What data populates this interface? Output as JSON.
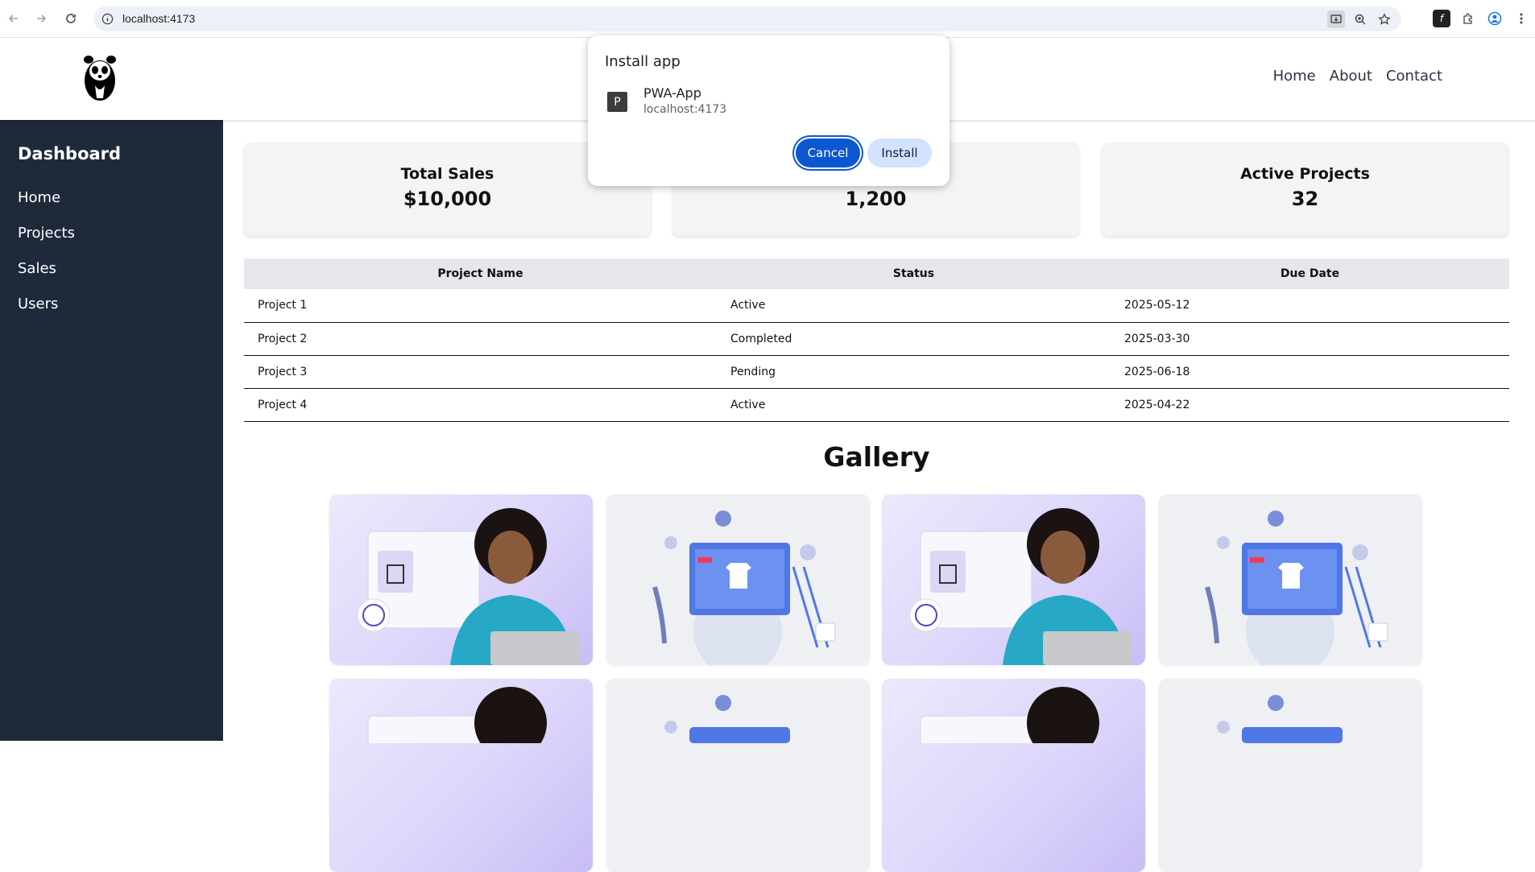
{
  "browser": {
    "url": "localhost:4173"
  },
  "header": {
    "nav": [
      "Home",
      "About",
      "Contact"
    ]
  },
  "sidebar": {
    "title": "Dashboard",
    "items": [
      "Home",
      "Projects",
      "Sales",
      "Users"
    ]
  },
  "cards": [
    {
      "label": "Total Sales",
      "value": "$10,000"
    },
    {
      "label": "",
      "value": "1,200"
    },
    {
      "label": "Active Projects",
      "value": "32"
    }
  ],
  "table": {
    "headers": [
      "Project Name",
      "Status",
      "Due Date"
    ],
    "rows": [
      [
        "Project 1",
        "Active",
        "2025-05-12"
      ],
      [
        "Project 2",
        "Completed",
        "2025-03-30"
      ],
      [
        "Project 3",
        "Pending",
        "2025-06-18"
      ],
      [
        "Project 4",
        "Active",
        "2025-04-22"
      ]
    ]
  },
  "gallery": {
    "title": "Gallery"
  },
  "install_popup": {
    "title": "Install app",
    "app_initial": "P",
    "app_name": "PWA-App",
    "app_url": "localhost:4173",
    "cancel_label": "Cancel",
    "install_label": "Install"
  },
  "colors": {
    "sidebar_bg": "#1e2939",
    "card_bg": "#f3f4f6",
    "table_header_bg": "#e5e7eb",
    "primary_button": "#0b57d0",
    "secondary_button": "#d3e3fd"
  },
  "icons": [
    "back-icon",
    "forward-icon",
    "reload-icon",
    "site-info-icon",
    "install-app-icon",
    "zoom-icon",
    "bookmark-star-icon",
    "font-extension-icon",
    "extensions-icon",
    "profile-icon",
    "menu-icon",
    "panda-logo"
  ]
}
